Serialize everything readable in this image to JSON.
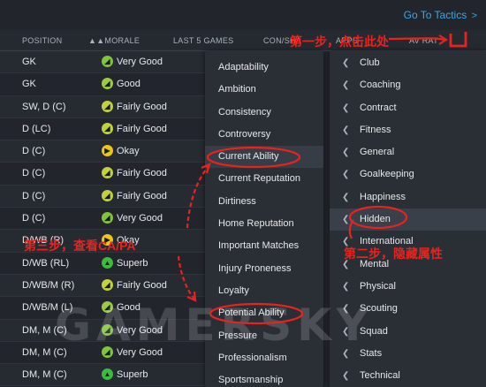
{
  "header": {
    "go_tactics": "Go To Tactics",
    "chevron": ">"
  },
  "columns": [
    "POSITION",
    "MORALE",
    "LAST 5 GAMES",
    "CON/SHA",
    "APPS",
    "AV RAT"
  ],
  "sort_indicator": "▲▲",
  "rows": [
    {
      "position": "GK",
      "morale": "Very Good",
      "color": "#7fc43a",
      "icon": "◢"
    },
    {
      "position": "GK",
      "morale": "Good",
      "color": "#9bcc3f",
      "icon": "◢"
    },
    {
      "position": "SW, D (C)",
      "morale": "Fairly Good",
      "color": "#c2d23a",
      "icon": "◢"
    },
    {
      "position": "D (LC)",
      "morale": "Fairly Good",
      "color": "#c2d23a",
      "icon": "◢"
    },
    {
      "position": "D (C)",
      "morale": "Okay",
      "color": "#f0c419",
      "icon": "▶"
    },
    {
      "position": "D (C)",
      "morale": "Fairly Good",
      "color": "#c2d23a",
      "icon": "◢"
    },
    {
      "position": "D (C)",
      "morale": "Fairly Good",
      "color": "#c2d23a",
      "icon": "◢"
    },
    {
      "position": "D (C)",
      "morale": "Very Good",
      "color": "#7fc43a",
      "icon": "◢"
    },
    {
      "position": "D/WB (R)",
      "morale": "Okay",
      "color": "#f0c419",
      "icon": "▶"
    },
    {
      "position": "D/WB (RL)",
      "morale": "Superb",
      "color": "#3cbc3c",
      "icon": "▲"
    },
    {
      "position": "D/WB/M (R)",
      "morale": "Fairly Good",
      "color": "#c2d23a",
      "icon": "◢"
    },
    {
      "position": "D/WB/M (L)",
      "morale": "Good",
      "color": "#9bcc3f",
      "icon": "◢"
    },
    {
      "position": "DM, M (C)",
      "morale": "Very Good",
      "color": "#7fc43a",
      "icon": "◢"
    },
    {
      "position": "DM, M (C)",
      "morale": "Very Good",
      "color": "#7fc43a",
      "icon": "◢"
    },
    {
      "position": "DM, M (C)",
      "morale": "Superb",
      "color": "#3cbc3c",
      "icon": "▲"
    }
  ],
  "attributes_menu": [
    "Adaptability",
    "Ambition",
    "Consistency",
    "Controversy",
    "Current Ability",
    "Current Reputation",
    "Dirtiness",
    "Home Reputation",
    "Important Matches",
    "Injury Proneness",
    "Loyalty",
    "Potential Ability",
    "Pressure",
    "Professionalism",
    "Sportsmanship"
  ],
  "category_menu": [
    "Club",
    "Coaching",
    "Contract",
    "Fitness",
    "General",
    "Goalkeeping",
    "Happiness",
    "Hidden",
    "International",
    "Mental",
    "Physical",
    "Scouting",
    "Squad",
    "Stats",
    "Technical"
  ],
  "annotations": {
    "step1": "第一步，点击此处",
    "step2": "第二步，隐藏属性",
    "step3": "第三步，查看CA/PA"
  },
  "watermark": "GAMERSKY",
  "colors": {
    "accent": "#39a7e8",
    "annotation": "#e8231e"
  }
}
